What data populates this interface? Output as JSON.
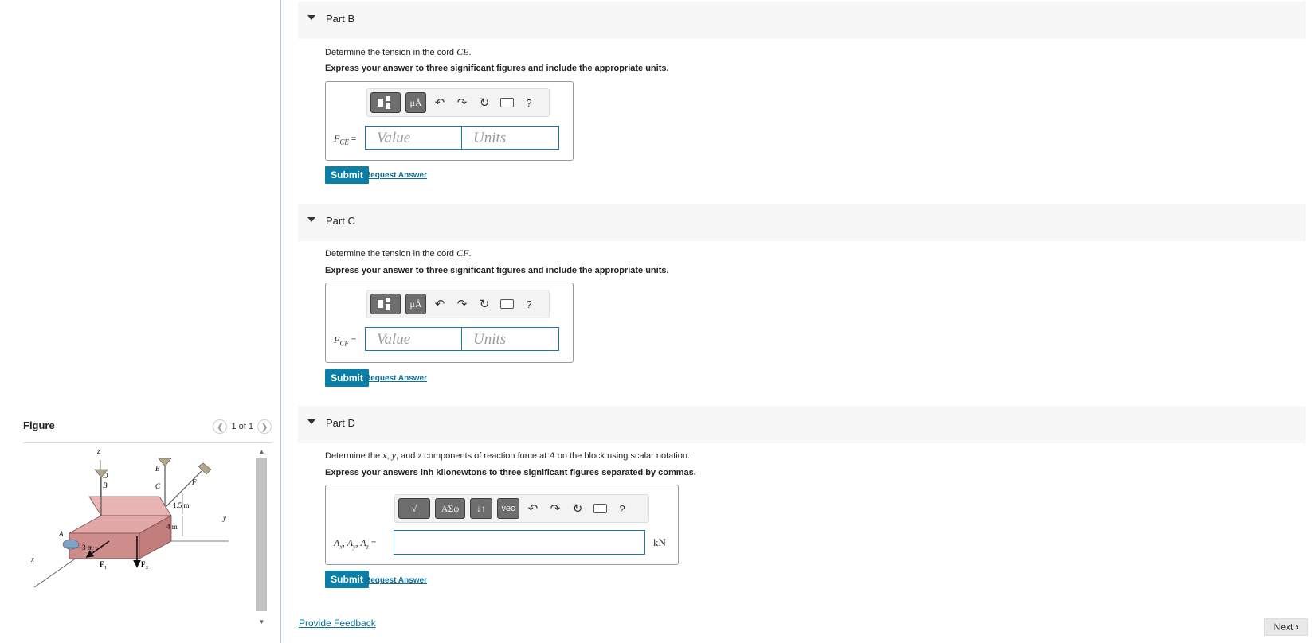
{
  "figure": {
    "title": "Figure",
    "counter": "1 of 1",
    "labels": {
      "z": "z",
      "x": "x",
      "y": "y",
      "A": "A",
      "B": "B",
      "C": "C",
      "D": "D",
      "E": "E",
      "F": "F",
      "dim_15": "1.5 m",
      "dim_4": "4 m",
      "dim_3": "3 m",
      "F1": "F",
      "F1_sub": "1",
      "F2": "F",
      "F2_sub": "2"
    }
  },
  "parts": [
    {
      "title": "Part B",
      "prompt_prefix": "Determine the tension in the cord ",
      "prompt_var": "CE",
      "prompt_suffix": ".",
      "instructions": "Express your answer to three significant figures and include the appropriate units.",
      "var": "F",
      "var_sub": "CE",
      "eq": " =",
      "value_placeholder": "Value",
      "units_placeholder": "Units",
      "toolbar": [
        "templates-icon",
        "mu-a-icon",
        "undo-icon",
        "redo-icon",
        "reset-icon",
        "keyboard-icon",
        "help-icon"
      ],
      "mu_label": "μÅ",
      "help": "?",
      "submit": "Submit",
      "request": "Request Answer"
    },
    {
      "title": "Part C",
      "prompt_prefix": "Determine the tension in the cord ",
      "prompt_var": "CF",
      "prompt_suffix": ".",
      "instructions": "Express your answer to three significant figures and include the appropriate units.",
      "var": "F",
      "var_sub": "CF",
      "eq": " =",
      "value_placeholder": "Value",
      "units_placeholder": "Units",
      "mu_label": "μÅ",
      "help": "?",
      "submit": "Submit",
      "request": "Request Answer"
    },
    {
      "title": "Part D",
      "prompt_a": "Determine the ",
      "prompt_x": "x",
      "prompt_b": ", ",
      "prompt_y": "y",
      "prompt_c": ", and ",
      "prompt_z": "z",
      "prompt_d": " components of reaction force at ",
      "prompt_A": "A",
      "prompt_e": " on the block using scalar notation.",
      "instructions": "Express your answers inh kilonewtons to three significant figures separated by commas.",
      "var_label": "Ax, Ay, Az",
      "var_A1": "A",
      "var_s1": "x",
      "var_sep1": ", ",
      "var_A2": "A",
      "var_s2": "y",
      "var_sep2": ", ",
      "var_A3": "A",
      "var_s3": "z",
      "eq": " =",
      "unit": "kN",
      "sqrt_label": "√",
      "greek_label": "ΑΣφ",
      "arrows_label": "↓↑",
      "vec_label": "vec",
      "help": "?",
      "submit": "Submit",
      "request": "Request Answer"
    }
  ],
  "footer": {
    "feedback": "Provide Feedback",
    "next": "Next"
  }
}
